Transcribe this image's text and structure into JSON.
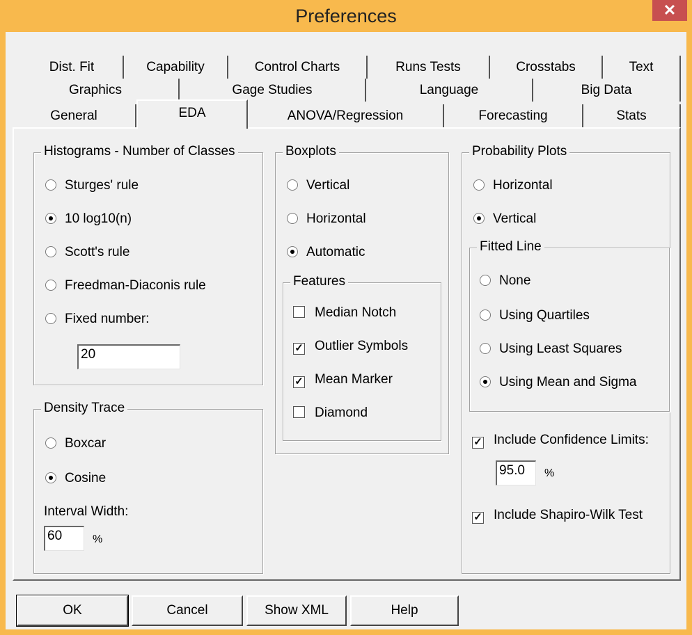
{
  "window": {
    "title": "Preferences",
    "close_glyph": "✕"
  },
  "tabs": {
    "row1": [
      "Dist. Fit",
      "Capability",
      "Control Charts",
      "Runs Tests",
      "Crosstabs",
      "Text"
    ],
    "row2": [
      "Graphics",
      "Gage Studies",
      "Language",
      "Big Data"
    ],
    "row3": [
      "General",
      "EDA",
      "ANOVA/Regression",
      "Forecasting",
      "Stats"
    ],
    "active": "EDA"
  },
  "histograms": {
    "legend": "Histograms - Number of Classes",
    "options": [
      "Sturges' rule",
      "10 log10(n)",
      "Scott's rule",
      "Freedman-Diaconis rule",
      "Fixed number:"
    ],
    "selected": "10 log10(n)",
    "fixed_value": "20"
  },
  "density": {
    "legend": "Density Trace",
    "options": [
      "Boxcar",
      "Cosine"
    ],
    "selected": "Cosine",
    "interval_label": "Interval Width:",
    "interval_value": "60",
    "unit": "%"
  },
  "boxplots": {
    "legend": "Boxplots",
    "options": [
      "Vertical",
      "Horizontal",
      "Automatic"
    ],
    "selected": "Automatic",
    "features_legend": "Features",
    "features": [
      {
        "label": "Median Notch",
        "checked": false
      },
      {
        "label": "Outlier Symbols",
        "checked": true
      },
      {
        "label": "Mean Marker",
        "checked": true
      },
      {
        "label": "Diamond",
        "checked": false
      }
    ]
  },
  "probability": {
    "legend": "Probability Plots",
    "options": [
      "Horizontal",
      "Vertical"
    ],
    "selected": "Vertical",
    "fitted_legend": "Fitted Line",
    "fitted_options": [
      "None",
      "Using Quartiles",
      "Using Least Squares",
      "Using Mean and Sigma"
    ],
    "fitted_selected": "Using Mean and Sigma",
    "conf_label": "Include Confidence Limits:",
    "conf_checked": true,
    "conf_value": "95.0",
    "conf_unit": "%",
    "shapiro_label": "Include Shapiro-Wilk Test",
    "shapiro_checked": true
  },
  "buttons": {
    "ok": "OK",
    "cancel": "Cancel",
    "show_xml": "Show XML",
    "help": "Help"
  }
}
